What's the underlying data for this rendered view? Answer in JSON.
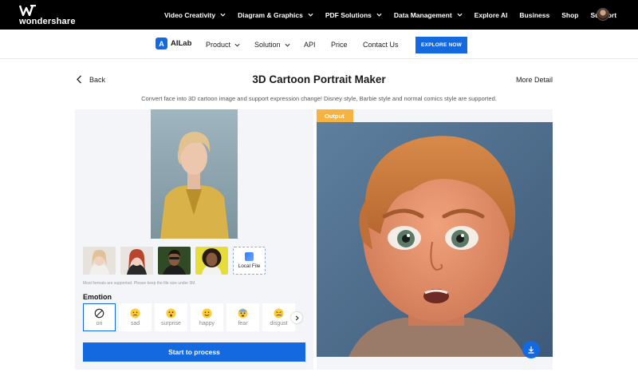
{
  "brand": {
    "name": "wondershare"
  },
  "topnav": {
    "items": [
      {
        "label": "Video Creativity",
        "dropdown": true
      },
      {
        "label": "Diagram & Graphics",
        "dropdown": true
      },
      {
        "label": "PDF Solutions",
        "dropdown": true
      },
      {
        "label": "Data Management",
        "dropdown": true
      },
      {
        "label": "Explore AI",
        "dropdown": false
      },
      {
        "label": "Business",
        "dropdown": false
      },
      {
        "label": "Shop",
        "dropdown": false
      },
      {
        "label": "Support",
        "dropdown": false
      }
    ]
  },
  "subnav": {
    "logo_letter": "A",
    "logo_label": "AILab",
    "product": "Product",
    "solution": "Solution",
    "api": "API",
    "price": "Price",
    "contact": "Contact Us",
    "explore": "EXPLORE NOW"
  },
  "page": {
    "back": "Back",
    "title": "3D Cartoon Portrait Maker",
    "more": "More Detail",
    "subtitle": "Convert face into 3D cartoon image and support expression change! Disney style, Barbie style and normal comics style are supported."
  },
  "input": {
    "local_file": "Local File",
    "note": "Most formats are supported. Please keep the file size under 3M.",
    "emotion_label": "Emotion",
    "emotions": [
      "ori",
      "sad",
      "surprise",
      "happy",
      "fear",
      "disgust"
    ],
    "selected_emotion": "ori",
    "process": "Start to process"
  },
  "output": {
    "tag": "Output"
  },
  "colors": {
    "accent": "#1468e0",
    "output_tag": "#f5b342",
    "panel": "#f3f5f8"
  }
}
